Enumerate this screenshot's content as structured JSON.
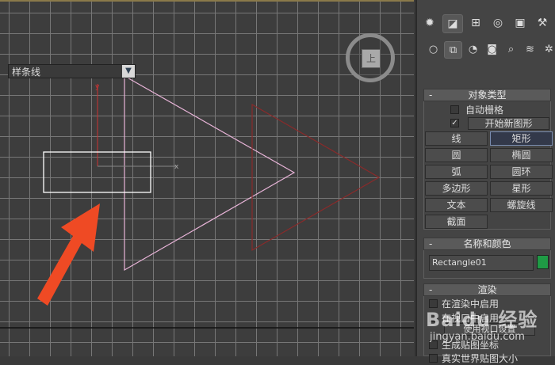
{
  "viewport": {
    "viewcube_label": "上",
    "arrow_color": "#ef4a24",
    "shapes": {
      "selection_rect": "white",
      "triangle_pink": "#e8b4d8",
      "triangle_dark": "#8a2a2a"
    }
  },
  "panel": {
    "top_tabs": [
      "create-icon",
      "modify-icon",
      "hierarchy-icon",
      "motion-icon",
      "display-icon",
      "utilities-icon"
    ],
    "sub_tabs": [
      "geometry-icon",
      "shapes-icon",
      "lights-icon",
      "cameras-icon",
      "helpers-icon",
      "spacewarps-icon",
      "systems-icon"
    ],
    "category": "样条线",
    "object_type": {
      "title": "对象类型",
      "auto_grid": "自动栅格",
      "start_new_shape": "开始新图形",
      "buttons": [
        "线",
        "矩形",
        "圆",
        "椭圆",
        "弧",
        "圆环",
        "多边形",
        "星形",
        "文本",
        "螺旋线",
        "截面"
      ],
      "selected": "矩形"
    },
    "name_color": {
      "title": "名称和颜色",
      "name": "Rectangle01",
      "color": "#1f9a45"
    },
    "rendering": {
      "title": "渲染",
      "items": [
        "在渲染中启用",
        "在视口中启用",
        "使用视口设置",
        "生成贴图坐标",
        "真实世界贴图大小"
      ]
    }
  },
  "watermark": {
    "text": "Baidu 经验",
    "url": "jingyan.baidu.com"
  }
}
